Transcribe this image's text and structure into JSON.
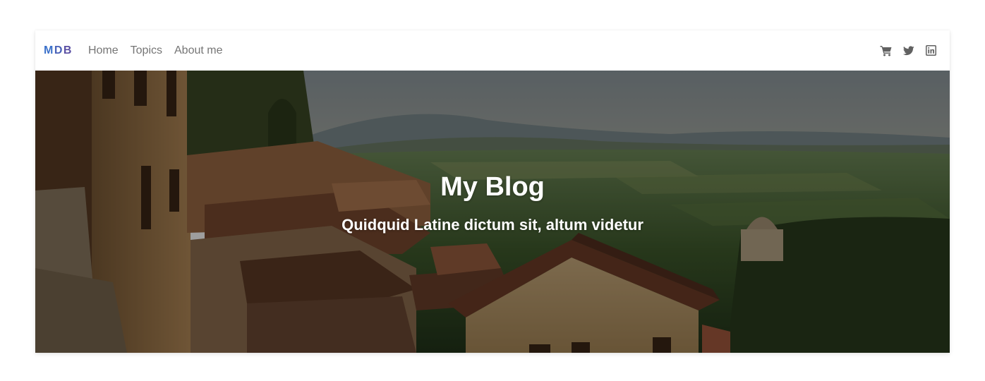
{
  "navbar": {
    "brand": {
      "letter_1": "M",
      "letter_2": "D",
      "letter_3": "B"
    },
    "links": [
      {
        "label": "Home"
      },
      {
        "label": "Topics"
      },
      {
        "label": "About me"
      }
    ],
    "icons": [
      "shopping-cart-icon",
      "twitter-icon",
      "linkedin-icon"
    ]
  },
  "hero": {
    "title": "My Blog",
    "subtitle": "Quidquid Latine dictum sit, altum videtur",
    "overlay_color": "rgba(0,0,0,0.38)"
  },
  "colors": {
    "nav_text": "#757575",
    "icon": "#616161",
    "brand_blue": "#3b71ca",
    "brand_purple": "#5a4fa3"
  }
}
